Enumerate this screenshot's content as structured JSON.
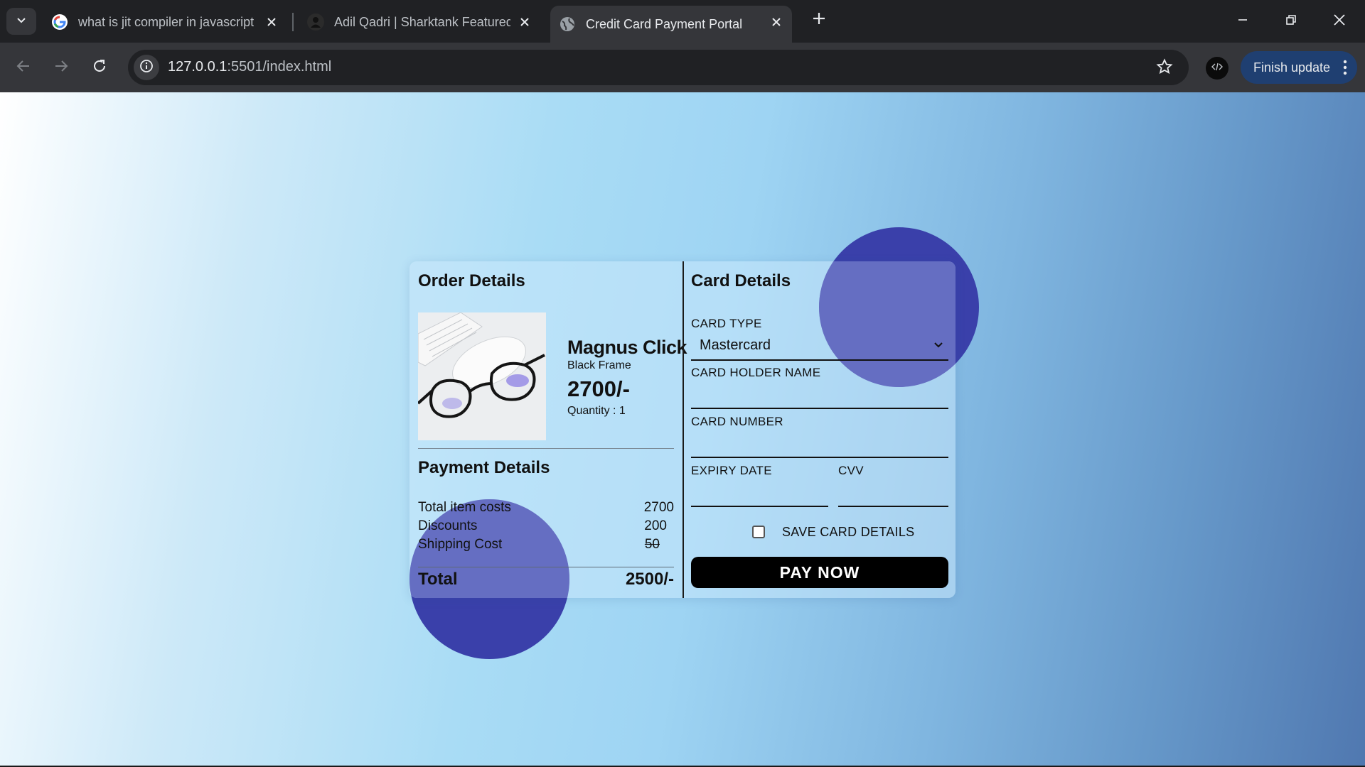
{
  "browser": {
    "tabs": [
      {
        "title": "what is jit compiler in javascript",
        "favicon": "google-icon",
        "active": false
      },
      {
        "title": "Adil Qadri | Sharktank Featured",
        "favicon": "profile-icon",
        "active": false
      },
      {
        "title": "Credit Card Payment Portal",
        "favicon": "globe-icon",
        "active": true
      }
    ],
    "url_host": "127.0.0.1",
    "url_path": ":5501/index.html",
    "update_label": "Finish update"
  },
  "order": {
    "title": "Order Details",
    "product": {
      "name": "Magnus Click",
      "variant": "Black Frame",
      "price": "2700/-",
      "quantity": "Quantity : 1"
    }
  },
  "payment": {
    "title": "Payment Details",
    "rows": [
      {
        "label": "Total item costs",
        "value": "2700"
      },
      {
        "label": "Discounts",
        "value": "200"
      },
      {
        "label": "Shipping Cost",
        "value": "50"
      }
    ],
    "total_label": "Total",
    "total_value": "2500/-"
  },
  "card": {
    "title": "Card Details",
    "type_label": "CARD TYPE",
    "type_value": "Mastercard",
    "holder_label": "CARD HOLDER NAME",
    "holder_value": "",
    "number_label": "CARD NUMBER",
    "number_value": "",
    "expiry_label": "EXPIRY DATE",
    "expiry_value": "",
    "cvv_label": "CVV",
    "cvv_value": "",
    "save_label": "SAVE CARD DETAILS",
    "save_checked": false,
    "pay_label": "PAY NOW"
  },
  "colors": {
    "accent_blob": "#3a40aa",
    "pay_button": "#000000",
    "update_button": "#1f3f71"
  }
}
